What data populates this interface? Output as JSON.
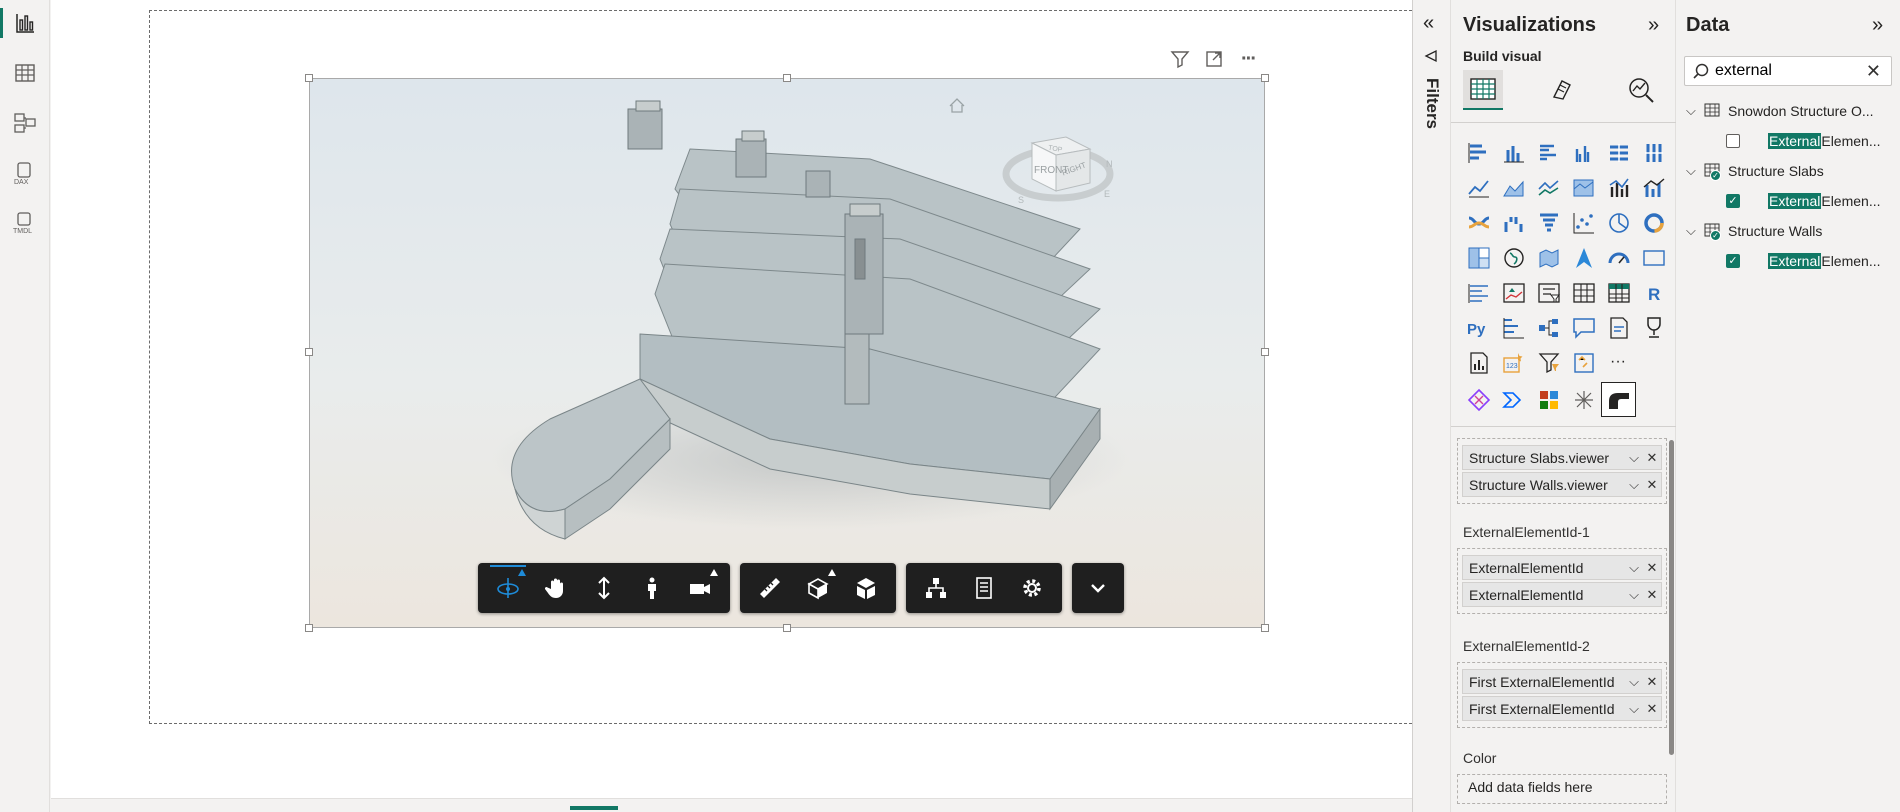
{
  "nav_rail": {
    "items": [
      {
        "name": "report-view",
        "icon": "bar-chart-icon",
        "active": true
      },
      {
        "name": "table-view",
        "icon": "table-icon"
      },
      {
        "name": "model-view",
        "icon": "model-icon"
      },
      {
        "name": "dax-query-view",
        "icon": "dax-icon",
        "label": "DAX"
      },
      {
        "name": "tmdl-view",
        "icon": "tmdl-icon",
        "label": "TMDL"
      }
    ]
  },
  "visual_header": {
    "icons": [
      "filter-icon",
      "focus-mode-icon",
      "more-options-icon"
    ],
    "more": "···"
  },
  "viewer": {
    "home_icon": "home-icon",
    "view_cube": {
      "top": "TOP",
      "front": "FRONT",
      "right": "RIGHT",
      "compass": [
        "N",
        "E",
        "S"
      ]
    },
    "toolbar": {
      "groups": [
        [
          "orbit-icon",
          "pan-icon",
          "zoom-icon",
          "first-person-icon",
          "camera-icon"
        ],
        [
          "measure-icon",
          "section-icon",
          "explode-icon"
        ],
        [
          "model-browser-icon",
          "properties-icon",
          "settings-icon"
        ],
        [
          "collapse-icon"
        ]
      ]
    }
  },
  "filters_pane": {
    "title": "Filters",
    "expand_icon": "double-chevron-left-icon"
  },
  "visualizations_pane": {
    "title": "Visualizations",
    "collapse_icon": "double-chevron-right-icon",
    "subtitle": "Build visual",
    "mode_tabs": [
      "build-visual-icon",
      "format-visual-icon",
      "analytics-icon"
    ],
    "field_wells": [
      {
        "label": "",
        "fields": [
          "Structure Slabs.viewer",
          "Structure Walls.viewer"
        ]
      },
      {
        "label": "ExternalElementId-1",
        "fields": [
          "ExternalElementId",
          "ExternalElementId"
        ]
      },
      {
        "label": "ExternalElementId-2",
        "fields": [
          "First ExternalElementId",
          "First ExternalElementId"
        ]
      },
      {
        "label": "Color",
        "placeholder": "Add data fields here"
      }
    ],
    "more_visuals": "···",
    "r_visual_label": "R",
    "python_visual_label": "Py",
    "card_label": "123"
  },
  "data_pane": {
    "title": "Data",
    "collapse_icon": "double-chevron-right-icon",
    "search": {
      "value": "external",
      "placeholder": "Search"
    },
    "tables": [
      {
        "name": "Snowdon Structure O...",
        "fields": [
          {
            "highlight": "External",
            "rest": "Elemen...",
            "checked": false
          }
        ],
        "checked": false
      },
      {
        "name": "Structure Slabs",
        "fields": [
          {
            "highlight": "External",
            "rest": "Elemen...",
            "checked": true
          }
        ],
        "checked": true
      },
      {
        "name": "Structure Walls",
        "fields": [
          {
            "highlight": "External",
            "rest": "Elemen...",
            "checked": true
          }
        ],
        "checked": true
      }
    ]
  },
  "colors": {
    "accent": "#117865",
    "toolbar": "#1f1f1f",
    "active_tool": "#1e8bd8"
  }
}
